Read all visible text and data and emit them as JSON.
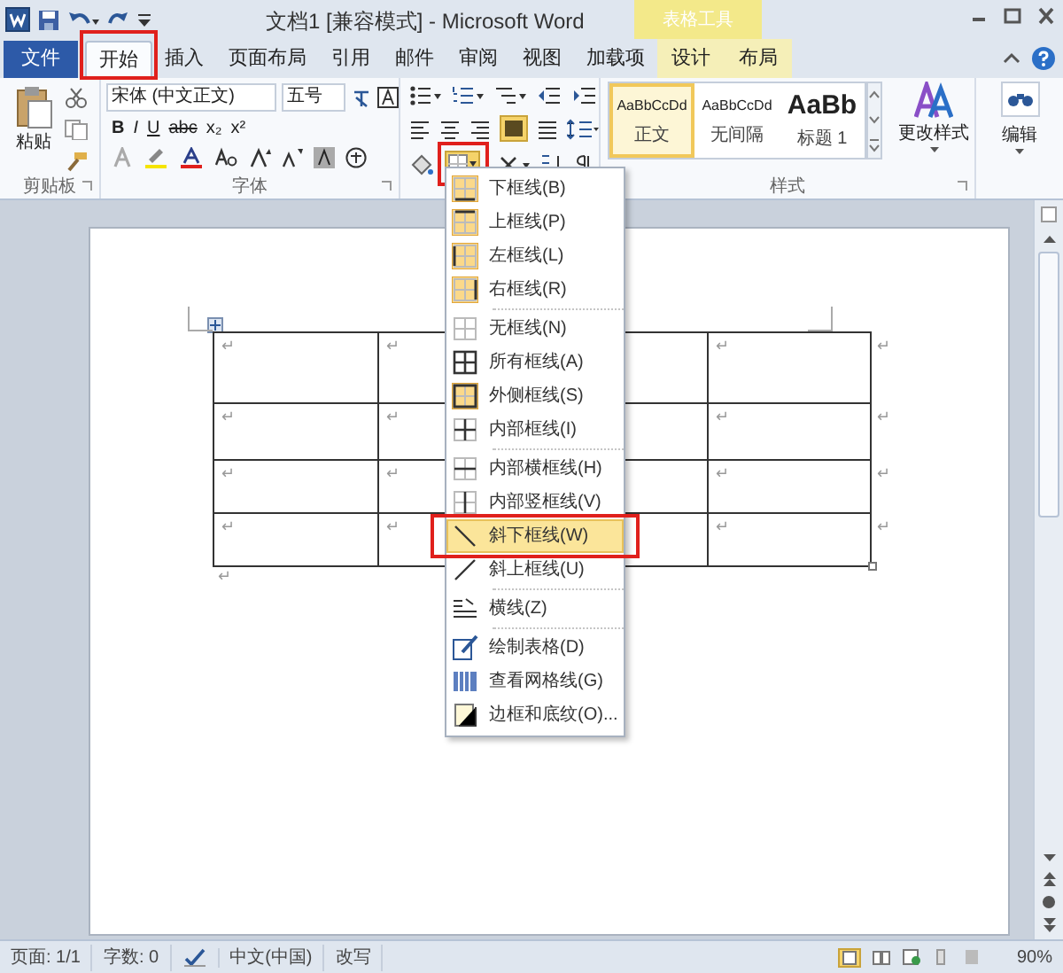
{
  "window": {
    "title": "文档1 [兼容模式] - Microsoft Word",
    "context_tab_group": "表格工具"
  },
  "tabs": [
    {
      "label": "文件",
      "kind": "file",
      "selected": false
    },
    {
      "label": "开始",
      "kind": "tab",
      "selected": true
    },
    {
      "label": "插入",
      "kind": "tab",
      "selected": false
    },
    {
      "label": "页面布局",
      "kind": "tab",
      "selected": false
    },
    {
      "label": "引用",
      "kind": "tab",
      "selected": false
    },
    {
      "label": "邮件",
      "kind": "tab",
      "selected": false
    },
    {
      "label": "审阅",
      "kind": "tab",
      "selected": false
    },
    {
      "label": "视图",
      "kind": "tab",
      "selected": false
    },
    {
      "label": "加载项",
      "kind": "tab",
      "selected": false
    },
    {
      "label": "设计",
      "kind": "context",
      "selected": false
    },
    {
      "label": "布局",
      "kind": "context",
      "selected": false
    }
  ],
  "ribbon": {
    "clipboard": {
      "paste_label": "粘贴",
      "group_label": "剪贴板"
    },
    "font": {
      "font_name": "宋体 (中文正文)",
      "font_size": "五号",
      "format_buttons": [
        "B",
        "I",
        "U",
        "abc",
        "x₂",
        "x²"
      ],
      "group_label": "字体"
    },
    "styles": {
      "gallery": [
        {
          "sample": "AaBbCcDd",
          "label": "正文",
          "selected": true,
          "kind": "normal"
        },
        {
          "sample": "AaBbCcDd",
          "label": "无间隔",
          "selected": false,
          "kind": "normal"
        },
        {
          "sample": "AaBb",
          "label": "标题 1",
          "selected": false,
          "kind": "heading"
        }
      ],
      "change_styles": "更改样式",
      "group_label": "样式"
    },
    "editing": {
      "label": "编辑"
    }
  },
  "border_menu": {
    "groups": [
      [
        {
          "label": "下框线(B)",
          "checked": true,
          "selected": false
        },
        {
          "label": "上框线(P)",
          "checked": true,
          "selected": false
        },
        {
          "label": "左框线(L)",
          "checked": true,
          "selected": false
        },
        {
          "label": "右框线(R)",
          "checked": true,
          "selected": false
        }
      ],
      [
        {
          "label": "无框线(N)",
          "checked": false,
          "selected": false
        },
        {
          "label": "所有框线(A)",
          "checked": false,
          "selected": false
        },
        {
          "label": "外侧框线(S)",
          "checked": true,
          "selected": false
        },
        {
          "label": "内部框线(I)",
          "checked": false,
          "selected": false
        }
      ],
      [
        {
          "label": "内部横框线(H)",
          "checked": false,
          "selected": false
        },
        {
          "label": "内部竖框线(V)",
          "checked": false,
          "selected": false
        },
        {
          "label": "斜下框线(W)",
          "checked": false,
          "selected": true
        },
        {
          "label": "斜上框线(U)",
          "checked": false,
          "selected": false
        }
      ],
      [
        {
          "label": "横线(Z)",
          "checked": false,
          "selected": false
        }
      ],
      [
        {
          "label": "绘制表格(D)",
          "checked": false,
          "selected": false
        },
        {
          "label": "查看网格线(G)",
          "checked": false,
          "selected": false
        },
        {
          "label": "边框和底纹(O)...",
          "checked": false,
          "selected": false
        }
      ]
    ]
  },
  "document": {
    "table": {
      "rows": [
        {
          "cells": [
            "↵",
            "↵",
            null,
            "↵"
          ],
          "end_mark": "↵"
        },
        {
          "cells": [
            "↵",
            "↵",
            null,
            "↵"
          ],
          "end_mark": "↵"
        },
        {
          "cells": [
            "↵",
            "↵",
            null,
            "↵"
          ],
          "end_mark": "↵"
        },
        {
          "cells": [
            "↵",
            "↵",
            null,
            "↵"
          ],
          "end_mark": "↵"
        }
      ]
    },
    "after_table": "↵"
  },
  "status_bar": {
    "items": [
      "页面: 1/1",
      "字数: 0",
      "中文(中国)",
      "改写"
    ],
    "zoom": "90%"
  }
}
